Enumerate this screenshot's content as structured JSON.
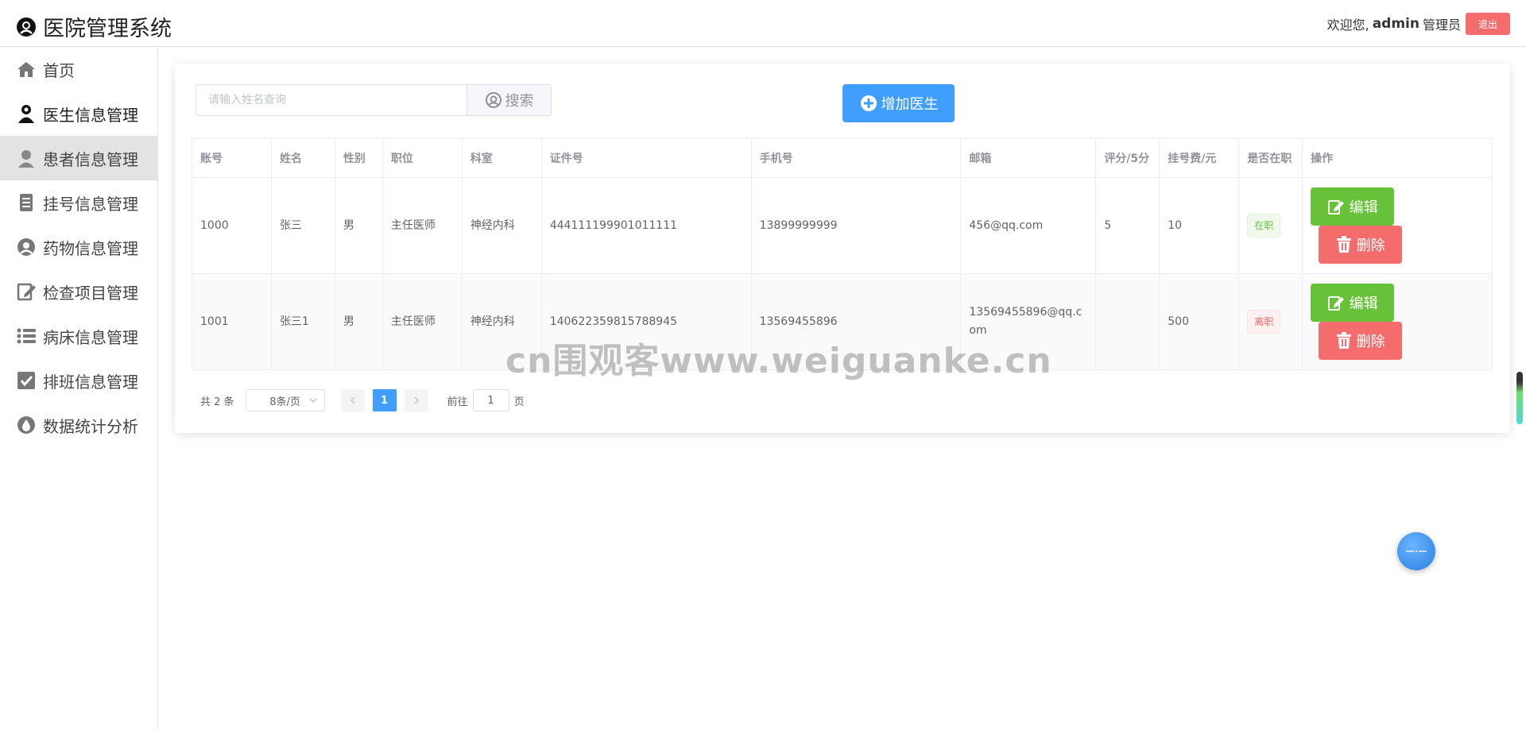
{
  "app": {
    "title": "医院管理系统"
  },
  "user": {
    "welcome": "欢迎您,",
    "name": "admin",
    "role": "管理员",
    "logout_label": "退出"
  },
  "sidebar": {
    "items": [
      {
        "label": "首页",
        "icon": "home-icon"
      },
      {
        "label": "医生信息管理",
        "icon": "doctor-icon"
      },
      {
        "label": "患者信息管理",
        "icon": "patient-icon"
      },
      {
        "label": "挂号信息管理",
        "icon": "document-icon"
      },
      {
        "label": "药物信息管理",
        "icon": "medicine-icon"
      },
      {
        "label": "检查项目管理",
        "icon": "edit-icon"
      },
      {
        "label": "病床信息管理",
        "icon": "list-icon"
      },
      {
        "label": "排班信息管理",
        "icon": "checkbox-icon"
      },
      {
        "label": "数据统计分析",
        "icon": "drop-icon"
      }
    ],
    "active_index": 2
  },
  "search": {
    "placeholder": "请输入姓名查询",
    "button_label": "搜索"
  },
  "add_button_label": "增加医生",
  "table": {
    "columns": [
      "账号",
      "姓名",
      "性别",
      "职位",
      "科室",
      "证件号",
      "手机号",
      "邮箱",
      "评分/5分",
      "挂号费/元",
      "是否在职",
      "操作"
    ],
    "rows": [
      {
        "account": "1000",
        "name": "张三",
        "gender": "男",
        "position": "主任医师",
        "department": "神经内科",
        "id_number": "444111199901011111",
        "phone": "13899999999",
        "email": "456@qq.com",
        "score": "5",
        "fee": "10",
        "status": "在职",
        "status_type": "on"
      },
      {
        "account": "1001",
        "name": "张三1",
        "gender": "男",
        "position": "主任医师",
        "department": "神经内科",
        "id_number": "140622359815788945",
        "phone": "13569455896",
        "email": "13569455896@qq.com",
        "score": "",
        "fee": "500",
        "status": "离职",
        "status_type": "off"
      }
    ],
    "edit_label": "编辑",
    "delete_label": "删除"
  },
  "pagination": {
    "total_text": "共 2 条",
    "page_size": "8条/页",
    "current_page": "1",
    "goto_prefix": "前往",
    "goto_value": "1",
    "goto_suffix": "页"
  },
  "watermark": "cn围观客www.weiguanke.cn",
  "colors": {
    "primary": "#409eff",
    "success": "#67c23a",
    "danger": "#f56c6c"
  }
}
